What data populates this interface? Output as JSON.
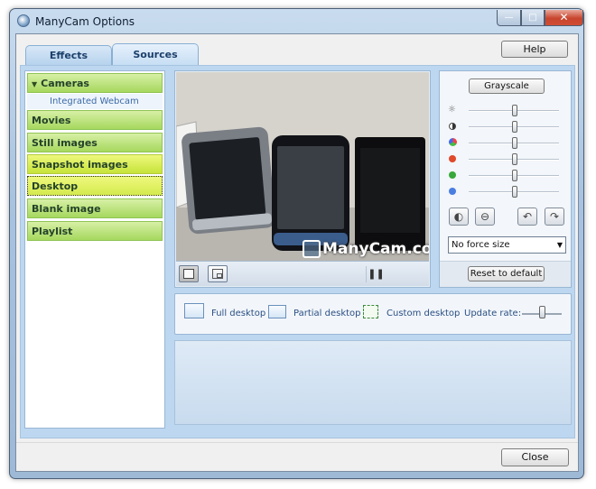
{
  "window": {
    "title": "ManyCam Options",
    "minimize": "—",
    "maximize": "□",
    "close": "✕"
  },
  "tabs": [
    {
      "label": "Effects"
    },
    {
      "label": "Sources"
    }
  ],
  "help_label": "Help",
  "sources": {
    "cameras": {
      "label": "Cameras",
      "expanded": true,
      "devices": [
        "Integrated Webcam"
      ]
    },
    "categories": [
      "Movies",
      "Still images",
      "Snapshot images",
      "Desktop",
      "Blank image",
      "Playlist"
    ],
    "selected": "Desktop"
  },
  "preview": {
    "watermark": "ManyCam.com",
    "pause_icon": "pause-icon"
  },
  "adjustments": {
    "grayscale_label": "Grayscale",
    "sliders": [
      {
        "name": "brightness",
        "icon": "sun-icon",
        "value": 0.5
      },
      {
        "name": "contrast",
        "icon": "contrast-icon",
        "value": 0.5
      },
      {
        "name": "saturation",
        "icon": "color-dots-icon",
        "value": 0.5
      },
      {
        "name": "red",
        "icon": "red-dot-icon",
        "color": "#e0492a",
        "value": 0.5
      },
      {
        "name": "green",
        "icon": "green-dot-icon",
        "color": "#39a83a",
        "value": 0.5
      },
      {
        "name": "blue",
        "icon": "blue-dot-icon",
        "color": "#4a7ee0",
        "value": 0.5
      }
    ],
    "size_select": "No force size",
    "reset_label": "Reset to default"
  },
  "desktop_options": {
    "full": "Full desktop",
    "partial": "Partial desktop",
    "custom": "Custom desktop",
    "update_rate_label": "Update rate:"
  },
  "footer": {
    "close_label": "Close"
  },
  "colors": {
    "accent_green": "#a6d85e",
    "selected_yellow": "#d4ea4e",
    "panel_blue": "#bcd7ef"
  }
}
